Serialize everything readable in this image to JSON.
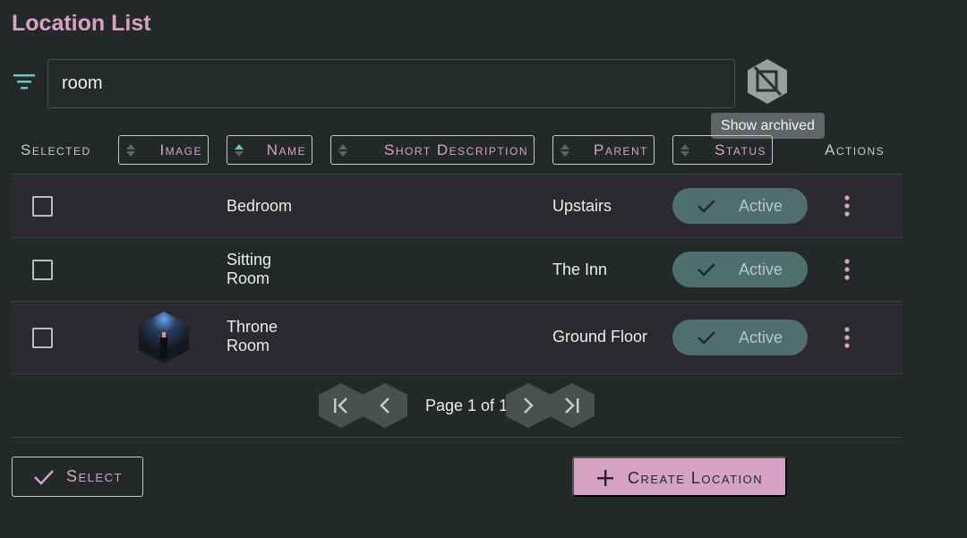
{
  "page_title": "Location List",
  "search": {
    "value": "room",
    "placeholder": ""
  },
  "archive_tooltip": "Show archived",
  "columns": {
    "selected": "Selected",
    "image": "Image",
    "name": "Name",
    "short_description": "Short Description",
    "parent": "Parent",
    "status": "Status",
    "actions": "Actions"
  },
  "rows": [
    {
      "name": "Bedroom",
      "name_line2": "",
      "short_description": "",
      "parent": "Upstairs",
      "status": "Active",
      "has_image": false
    },
    {
      "name": "Sitting",
      "name_line2": "Room",
      "short_description": "",
      "parent": "The Inn",
      "status": "Active",
      "has_image": false
    },
    {
      "name": "Throne",
      "name_line2": "Room",
      "short_description": "",
      "parent": "Ground Floor",
      "status": "Active",
      "has_image": true
    }
  ],
  "pagination": {
    "label": "Page 1 of 1"
  },
  "footer": {
    "select_label": "Select",
    "create_label": "Create Location"
  },
  "colors": {
    "accent": "#d9a2c4",
    "background": "#232929",
    "status_chip": "#4f6e6e",
    "teal": "#67c7c0"
  },
  "icons": [
    "filter-icon",
    "archive-toggle-icon",
    "sort-icon",
    "check-icon",
    "more-vert-icon",
    "first-page-icon",
    "prev-page-icon",
    "next-page-icon",
    "last-page-icon",
    "plus-icon"
  ]
}
